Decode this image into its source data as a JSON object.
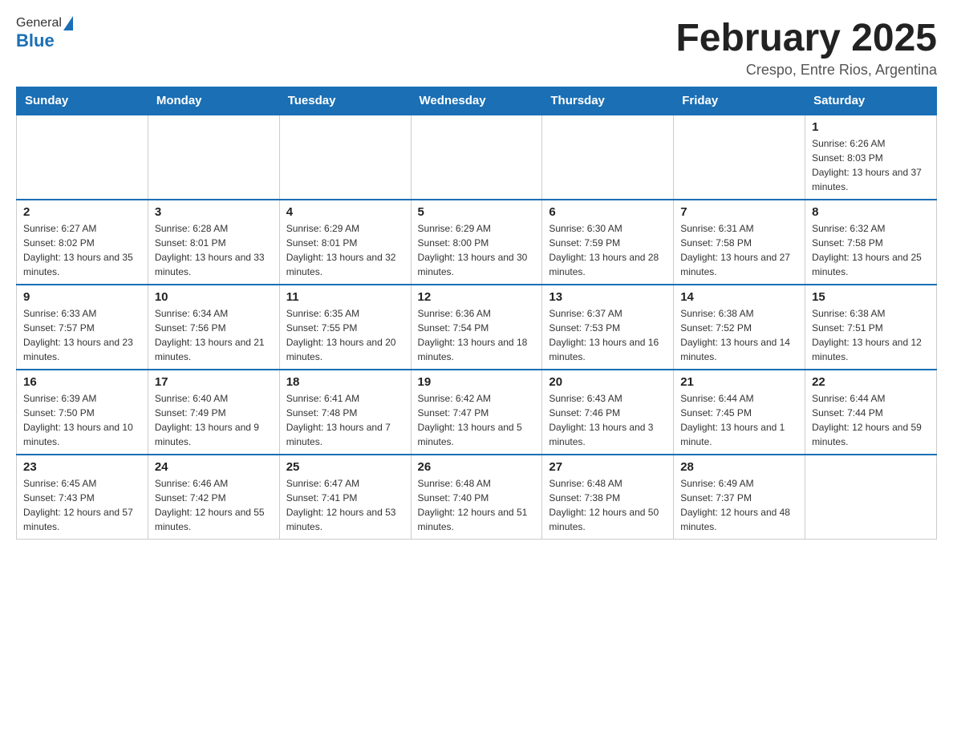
{
  "header": {
    "logo_general": "General",
    "logo_blue": "Blue",
    "title": "February 2025",
    "subtitle": "Crespo, Entre Rios, Argentina"
  },
  "days_of_week": [
    "Sunday",
    "Monday",
    "Tuesday",
    "Wednesday",
    "Thursday",
    "Friday",
    "Saturday"
  ],
  "weeks": [
    [
      {
        "day": "",
        "info": ""
      },
      {
        "day": "",
        "info": ""
      },
      {
        "day": "",
        "info": ""
      },
      {
        "day": "",
        "info": ""
      },
      {
        "day": "",
        "info": ""
      },
      {
        "day": "",
        "info": ""
      },
      {
        "day": "1",
        "info": "Sunrise: 6:26 AM\nSunset: 8:03 PM\nDaylight: 13 hours and 37 minutes."
      }
    ],
    [
      {
        "day": "2",
        "info": "Sunrise: 6:27 AM\nSunset: 8:02 PM\nDaylight: 13 hours and 35 minutes."
      },
      {
        "day": "3",
        "info": "Sunrise: 6:28 AM\nSunset: 8:01 PM\nDaylight: 13 hours and 33 minutes."
      },
      {
        "day": "4",
        "info": "Sunrise: 6:29 AM\nSunset: 8:01 PM\nDaylight: 13 hours and 32 minutes."
      },
      {
        "day": "5",
        "info": "Sunrise: 6:29 AM\nSunset: 8:00 PM\nDaylight: 13 hours and 30 minutes."
      },
      {
        "day": "6",
        "info": "Sunrise: 6:30 AM\nSunset: 7:59 PM\nDaylight: 13 hours and 28 minutes."
      },
      {
        "day": "7",
        "info": "Sunrise: 6:31 AM\nSunset: 7:58 PM\nDaylight: 13 hours and 27 minutes."
      },
      {
        "day": "8",
        "info": "Sunrise: 6:32 AM\nSunset: 7:58 PM\nDaylight: 13 hours and 25 minutes."
      }
    ],
    [
      {
        "day": "9",
        "info": "Sunrise: 6:33 AM\nSunset: 7:57 PM\nDaylight: 13 hours and 23 minutes."
      },
      {
        "day": "10",
        "info": "Sunrise: 6:34 AM\nSunset: 7:56 PM\nDaylight: 13 hours and 21 minutes."
      },
      {
        "day": "11",
        "info": "Sunrise: 6:35 AM\nSunset: 7:55 PM\nDaylight: 13 hours and 20 minutes."
      },
      {
        "day": "12",
        "info": "Sunrise: 6:36 AM\nSunset: 7:54 PM\nDaylight: 13 hours and 18 minutes."
      },
      {
        "day": "13",
        "info": "Sunrise: 6:37 AM\nSunset: 7:53 PM\nDaylight: 13 hours and 16 minutes."
      },
      {
        "day": "14",
        "info": "Sunrise: 6:38 AM\nSunset: 7:52 PM\nDaylight: 13 hours and 14 minutes."
      },
      {
        "day": "15",
        "info": "Sunrise: 6:38 AM\nSunset: 7:51 PM\nDaylight: 13 hours and 12 minutes."
      }
    ],
    [
      {
        "day": "16",
        "info": "Sunrise: 6:39 AM\nSunset: 7:50 PM\nDaylight: 13 hours and 10 minutes."
      },
      {
        "day": "17",
        "info": "Sunrise: 6:40 AM\nSunset: 7:49 PM\nDaylight: 13 hours and 9 minutes."
      },
      {
        "day": "18",
        "info": "Sunrise: 6:41 AM\nSunset: 7:48 PM\nDaylight: 13 hours and 7 minutes."
      },
      {
        "day": "19",
        "info": "Sunrise: 6:42 AM\nSunset: 7:47 PM\nDaylight: 13 hours and 5 minutes."
      },
      {
        "day": "20",
        "info": "Sunrise: 6:43 AM\nSunset: 7:46 PM\nDaylight: 13 hours and 3 minutes."
      },
      {
        "day": "21",
        "info": "Sunrise: 6:44 AM\nSunset: 7:45 PM\nDaylight: 13 hours and 1 minute."
      },
      {
        "day": "22",
        "info": "Sunrise: 6:44 AM\nSunset: 7:44 PM\nDaylight: 12 hours and 59 minutes."
      }
    ],
    [
      {
        "day": "23",
        "info": "Sunrise: 6:45 AM\nSunset: 7:43 PM\nDaylight: 12 hours and 57 minutes."
      },
      {
        "day": "24",
        "info": "Sunrise: 6:46 AM\nSunset: 7:42 PM\nDaylight: 12 hours and 55 minutes."
      },
      {
        "day": "25",
        "info": "Sunrise: 6:47 AM\nSunset: 7:41 PM\nDaylight: 12 hours and 53 minutes."
      },
      {
        "day": "26",
        "info": "Sunrise: 6:48 AM\nSunset: 7:40 PM\nDaylight: 12 hours and 51 minutes."
      },
      {
        "day": "27",
        "info": "Sunrise: 6:48 AM\nSunset: 7:38 PM\nDaylight: 12 hours and 50 minutes."
      },
      {
        "day": "28",
        "info": "Sunrise: 6:49 AM\nSunset: 7:37 PM\nDaylight: 12 hours and 48 minutes."
      },
      {
        "day": "",
        "info": ""
      }
    ]
  ]
}
